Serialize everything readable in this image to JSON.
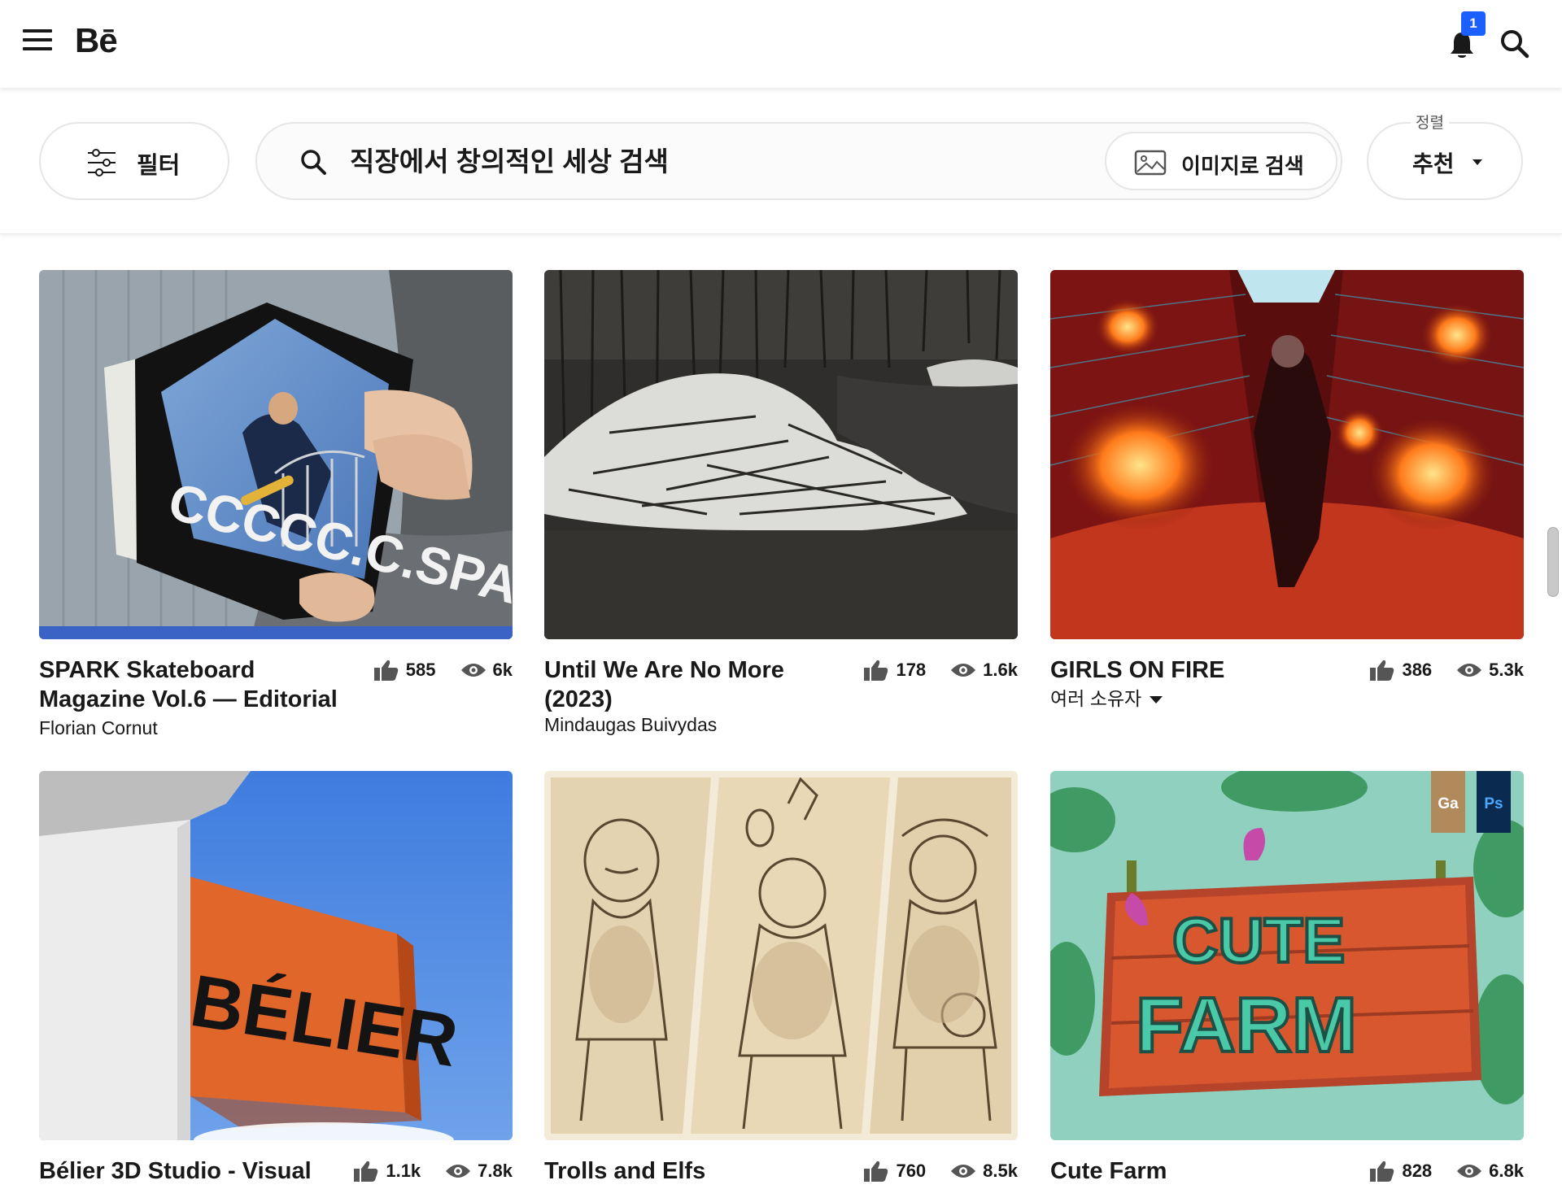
{
  "header": {
    "logo": "Bē",
    "notification_count": "1"
  },
  "toolbar": {
    "filter_label": "필터",
    "search_placeholder": "직장에서 창의적인 세상 검색",
    "image_search_label": "이미지로 검색",
    "sort_caption": "정렬",
    "sort_value": "추천"
  },
  "projects": [
    {
      "title": "SPARK Skateboard Magazine Vol.6 — Editorial",
      "owner": "Florian Cornut",
      "likes": "585",
      "views": "6k"
    },
    {
      "title": "Until We Are No More (2023)",
      "owner": "Mindaugas Buivydas",
      "likes": "178",
      "views": "1.6k"
    },
    {
      "title": "GIRLS ON FIRE",
      "owner": "여러 소유자",
      "likes": "386",
      "views": "5.3k"
    },
    {
      "title": "Bélier 3D Studio - Visual",
      "owner": "",
      "likes": "1.1k",
      "views": "7.8k"
    },
    {
      "title": "Trolls and Elfs",
      "owner": "",
      "likes": "760",
      "views": "8.5k"
    },
    {
      "title": "Cute Farm",
      "owner": "",
      "likes": "828",
      "views": "6.8k",
      "tools": [
        "Ga",
        "Ps"
      ]
    }
  ],
  "art_text": {
    "belier_sign": "BÉLIER",
    "cute_farm_top": "CUTE",
    "cute_farm_bottom": "FARM",
    "spark_cover": "CCCCC.C.SPA"
  },
  "colors": {
    "accent_blue": "#1b5fff",
    "text": "#191919"
  },
  "icons": [
    "menu-icon",
    "bell-icon",
    "search-icon",
    "filter-sliders-icon",
    "image-icon",
    "thumbs-up-icon",
    "eye-icon",
    "caret-down-icon"
  ]
}
